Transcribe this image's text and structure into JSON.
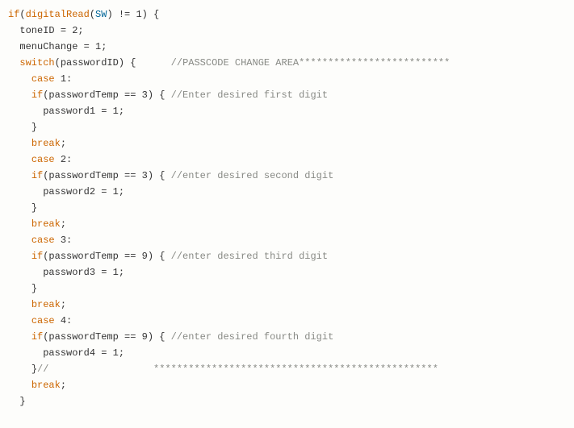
{
  "code": {
    "l1": {
      "kw": "if",
      "op1": "(",
      "func": "digitalRead",
      "op2": "(",
      "const": "SW",
      "op3": ") != ",
      "num": "1",
      "op4": ") {"
    },
    "l2": {
      "indent": "  ",
      "id": "toneID = ",
      "num": "2",
      "semi": ";"
    },
    "l3": {
      "indent": "  ",
      "id": "menuChange = ",
      "num": "1",
      "semi": ";"
    },
    "l4": {
      "indent": "  ",
      "kw": "switch",
      "op": "(passwordID) {",
      "pad": "      ",
      "cmt": "//PASSCODE CHANGE AREA**************************"
    },
    "l5": {
      "indent": "    ",
      "kw": "case",
      "sp": " ",
      "num": "1",
      "colon": ":"
    },
    "l6": {
      "indent": "    ",
      "kw": "if",
      "op": "(passwordTemp == ",
      "num": "3",
      "op2": ") { ",
      "cmt": "//Enter desired first digit"
    },
    "l7": {
      "indent": "      ",
      "id": "password1 = ",
      "num": "1",
      "semi": ";"
    },
    "l8": {
      "indent": "    ",
      "brace": "}"
    },
    "l9": {
      "indent": "    ",
      "kw": "break",
      "semi": ";"
    },
    "l10": {
      "indent": "    ",
      "kw": "case",
      "sp": " ",
      "num": "2",
      "colon": ":"
    },
    "l11": {
      "indent": "    ",
      "kw": "if",
      "op": "(passwordTemp == ",
      "num": "3",
      "op2": ") { ",
      "cmt": "//enter desired second digit"
    },
    "l12": {
      "indent": "      ",
      "id": "password2 = ",
      "num": "1",
      "semi": ";"
    },
    "l13": {
      "indent": "    ",
      "brace": "}"
    },
    "l14": {
      "indent": "    ",
      "kw": "break",
      "semi": ";"
    },
    "l15": {
      "indent": "    ",
      "kw": "case",
      "sp": " ",
      "num": "3",
      "colon": ":"
    },
    "l16": {
      "indent": "    ",
      "kw": "if",
      "op": "(passwordTemp == ",
      "num": "9",
      "op2": ") { ",
      "cmt": "//enter desired third digit"
    },
    "l17": {
      "indent": "      ",
      "id": "password3 = ",
      "num": "1",
      "semi": ";"
    },
    "l18": {
      "indent": "    ",
      "brace": "}"
    },
    "l19": {
      "indent": "    ",
      "kw": "break",
      "semi": ";"
    },
    "l20": {
      "indent": "    ",
      "kw": "case",
      "sp": " ",
      "num": "4",
      "colon": ":"
    },
    "l21": {
      "indent": "    ",
      "kw": "if",
      "op": "(passwordTemp == ",
      "num": "9",
      "op2": ") { ",
      "cmt": "//enter desired fourth digit"
    },
    "l22": {
      "indent": "      ",
      "id": "password4 = ",
      "num": "1",
      "semi": ";"
    },
    "l23": {
      "indent": "    ",
      "brace": "}",
      "cmtprefix": "//",
      "pad": "                  ",
      "stars": "*************************************************"
    },
    "l24": {
      "indent": "    ",
      "kw": "break",
      "semi": ";"
    },
    "l25": {
      "indent": "  ",
      "brace": "}"
    }
  }
}
